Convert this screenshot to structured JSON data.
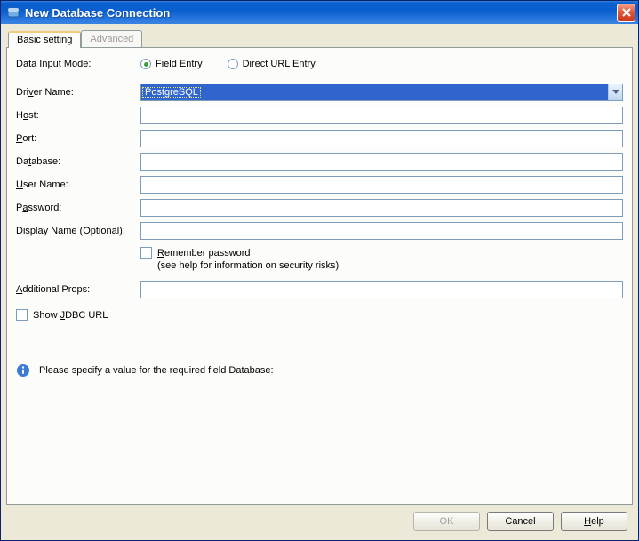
{
  "window": {
    "title": "New Database Connection"
  },
  "tabs": {
    "basic": "Basic setting",
    "advanced": "Advanced"
  },
  "labels": {
    "dataInputMode": "Data Input Mode:",
    "driverName": "Driver Name:",
    "host": "Host:",
    "port": "Port:",
    "database": "Database:",
    "userName": "User Name:",
    "password": "Password:",
    "displayName": "Display Name (Optional):",
    "additionalProps": "Additional Props:"
  },
  "radios": {
    "fieldEntry": "Field Entry",
    "directUrl": "Direct URL Entry"
  },
  "fields": {
    "driverName": "PostgreSQL",
    "host": "",
    "port": "",
    "database": "",
    "userName": "",
    "password": "",
    "displayName": "",
    "additionalProps": ""
  },
  "remember": {
    "line1": "Remember password",
    "line2": "(see help for information on security risks)"
  },
  "showJdbc": "Show JDBC URL",
  "infoMessage": "Please specify a value for the required field Database:",
  "buttons": {
    "ok": "OK",
    "cancel": "Cancel",
    "help": "Help"
  }
}
